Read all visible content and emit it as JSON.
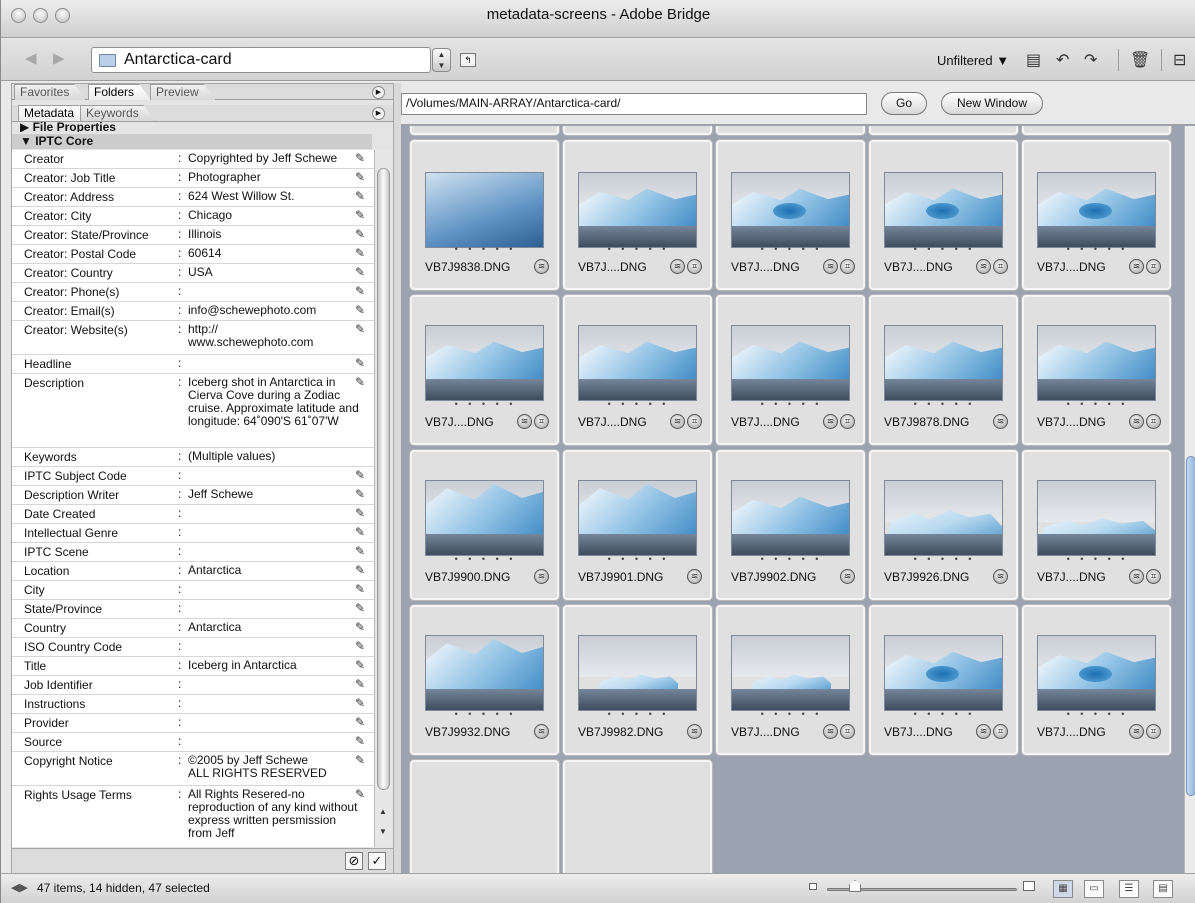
{
  "window": {
    "title": "metadata-screens - Adobe Bridge"
  },
  "toolbar": {
    "location": "Antarctica-card",
    "filter": "Unfiltered ▼",
    "icons": [
      "back-arrow-icon",
      "forward-arrow-icon",
      "folder-icon",
      "up-folder-icon",
      "new-folder-icon",
      "rotate-left-icon",
      "rotate-right-icon",
      "trash-icon",
      "compact-mode-icon"
    ]
  },
  "left_tabs_top": [
    "Favorites",
    "Folders",
    "Preview"
  ],
  "left_tabs_meta": [
    "Metadata",
    "Keywords"
  ],
  "sections": {
    "file_properties": "▶ File Properties",
    "iptc_core": "▼ IPTC Core"
  },
  "metadata": [
    {
      "label": "Creator",
      "value": "Copyrighted by Jeff Schewe"
    },
    {
      "label": "Creator: Job Title",
      "value": "Photographer"
    },
    {
      "label": "Creator: Address",
      "value": "624 West Willow St."
    },
    {
      "label": "Creator: City",
      "value": "Chicago"
    },
    {
      "label": "Creator: State/Province",
      "value": "Illinois"
    },
    {
      "label": "Creator: Postal Code",
      "value": "60614"
    },
    {
      "label": "Creator: Country",
      "value": "USA"
    },
    {
      "label": "Creator: Phone(s)",
      "value": ""
    },
    {
      "label": "Creator: Email(s)",
      "value": "info@schewephoto.com"
    },
    {
      "label": "Creator: Website(s)",
      "value": "http://\nwww.schewephoto.com"
    },
    {
      "label": "Headline",
      "value": ""
    },
    {
      "label": "Description",
      "value": "Iceberg shot in Antarctica in Cierva Cove during a Zodiac cruise. Approximate latitude and longitude: 64˚090'S 61˚07'W"
    },
    {
      "label": "Keywords",
      "value": "(Multiple values)"
    },
    {
      "label": "IPTC Subject Code",
      "value": ""
    },
    {
      "label": "Description Writer",
      "value": "Jeff Schewe"
    },
    {
      "label": "Date Created",
      "value": ""
    },
    {
      "label": "Intellectual Genre",
      "value": ""
    },
    {
      "label": "IPTC Scene",
      "value": ""
    },
    {
      "label": "Location",
      "value": "Antarctica"
    },
    {
      "label": "City",
      "value": ""
    },
    {
      "label": "State/Province",
      "value": ""
    },
    {
      "label": "Country",
      "value": "Antarctica"
    },
    {
      "label": "ISO Country Code",
      "value": ""
    },
    {
      "label": "Title",
      "value": "Iceberg in Antarctica"
    },
    {
      "label": "Job Identifier",
      "value": ""
    },
    {
      "label": "Instructions",
      "value": ""
    },
    {
      "label": "Provider",
      "value": ""
    },
    {
      "label": "Source",
      "value": ""
    },
    {
      "label": "Copyright Notice",
      "value": "©2005 by Jeff Schewe\nALL RIGHTS RESERVED"
    },
    {
      "label": "Rights Usage Terms",
      "value": "All Rights Resered-no reproduction of any kind without express written persmission from Jeff"
    }
  ],
  "pathbar": {
    "path": "/Volumes/MAIN-ARRAY/Antarctica-card/",
    "go": "Go",
    "new_window": "New Window"
  },
  "thumbnails": [
    [
      {
        "name": "VB7J9838.DNG",
        "badges": 1
      },
      {
        "name": "VB7J....DNG",
        "badges": 2
      },
      {
        "name": "VB7J....DNG",
        "badges": 2
      },
      {
        "name": "VB7J....DNG",
        "badges": 2
      },
      {
        "name": "VB7J....DNG",
        "badges": 2
      }
    ],
    [
      {
        "name": "VB7J....DNG",
        "badges": 2
      },
      {
        "name": "VB7J....DNG",
        "badges": 2
      },
      {
        "name": "VB7J....DNG",
        "badges": 2
      },
      {
        "name": "VB7J9878.DNG",
        "badges": 1
      },
      {
        "name": "VB7J....DNG",
        "badges": 2
      }
    ],
    [
      {
        "name": "VB7J9900.DNG",
        "badges": 1
      },
      {
        "name": "VB7J9901.DNG",
        "badges": 1
      },
      {
        "name": "VB7J9902.DNG",
        "badges": 1
      },
      {
        "name": "VB7J9926.DNG",
        "badges": 1
      },
      {
        "name": "VB7J....DNG",
        "badges": 2
      }
    ],
    [
      {
        "name": "VB7J9932.DNG",
        "badges": 1
      },
      {
        "name": "VB7J9982.DNG",
        "badges": 1
      },
      {
        "name": "VB7J....DNG",
        "badges": 2
      },
      {
        "name": "VB7J....DNG",
        "badges": 2
      },
      {
        "name": "VB7J....DNG",
        "badges": 2
      }
    ]
  ],
  "rating_dots": "• • • • •",
  "status": "47 items, 14 hidden, 47 selected",
  "colors": {
    "grid_bg": "#9aa3af",
    "panel_bg": "#e4e4e4",
    "scroll_accent": "#8fb5de"
  }
}
